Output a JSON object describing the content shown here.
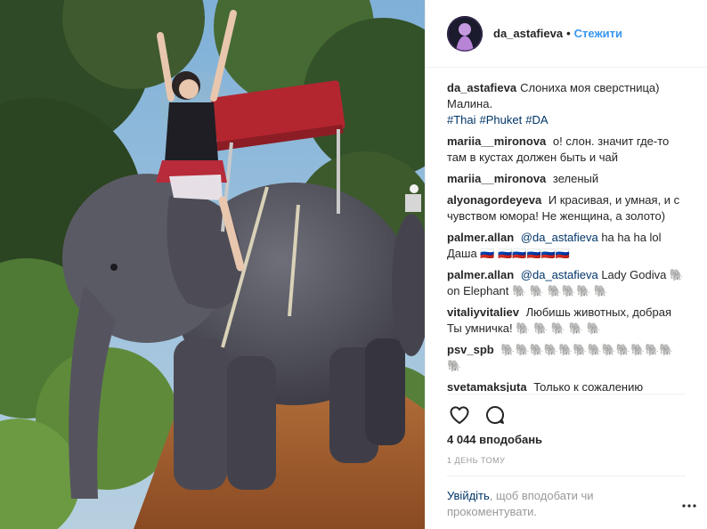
{
  "header": {
    "username": "da_astafieva",
    "separator": "•",
    "follow_label": "Стежити"
  },
  "caption": {
    "username": "da_astafieva",
    "text_line1": "Слониха моя сверстница)",
    "text_line2": "Малина.",
    "hashtags": [
      "#Thai",
      "#Phuket",
      "#DA"
    ]
  },
  "comments": [
    {
      "username": "mariia__mironova",
      "text": "о! слон. значит где-то там в кустах должен быть и чай"
    },
    {
      "username": "mariia__mironova",
      "text": "зеленый"
    },
    {
      "username": "alyonagordeyeva",
      "text": "И красивая, и умная, и с чувством юмора! Не женщина, а золото)"
    },
    {
      "username": "palmer.allan",
      "mention": "@da_astafieva",
      "text": "ha ha ha lol Даша 🇷🇺 🇷🇺🇷🇺🇷🇺🇷🇺🇷🇺"
    },
    {
      "username": "palmer.allan",
      "mention": "@da_astafieva",
      "text": "Lady Godiva 🐘 on Elephant 🐘 🐘 🐘🐘🐘 🐘"
    },
    {
      "username": "vitaliyvitaliev",
      "text": "Любишь животных, добрая Ты умничка! 🐘 🐘 🐘 🐘 🐘"
    },
    {
      "username": "psv_spb",
      "text": "🐘🐘🐘🐘🐘🐘🐘🐘🐘🐘🐘🐘🐘"
    },
    {
      "username": "svetamaksjuta",
      "text": "Только к сожалению слониха в рабстве(((("
    }
  ],
  "likes_text": "4 044 вподобань",
  "time_ago": "1 день тому",
  "login_prompt": {
    "link": "Увійдіть",
    "text": ", щоб вподобати чи прокоментувати."
  },
  "icons": {
    "like": "heart-icon",
    "comment": "comment-bubble-icon",
    "more": "more-options-icon"
  },
  "colors": {
    "link_blue": "#3897f0",
    "text": "#262626",
    "muted": "#999999",
    "mention": "#003569"
  }
}
